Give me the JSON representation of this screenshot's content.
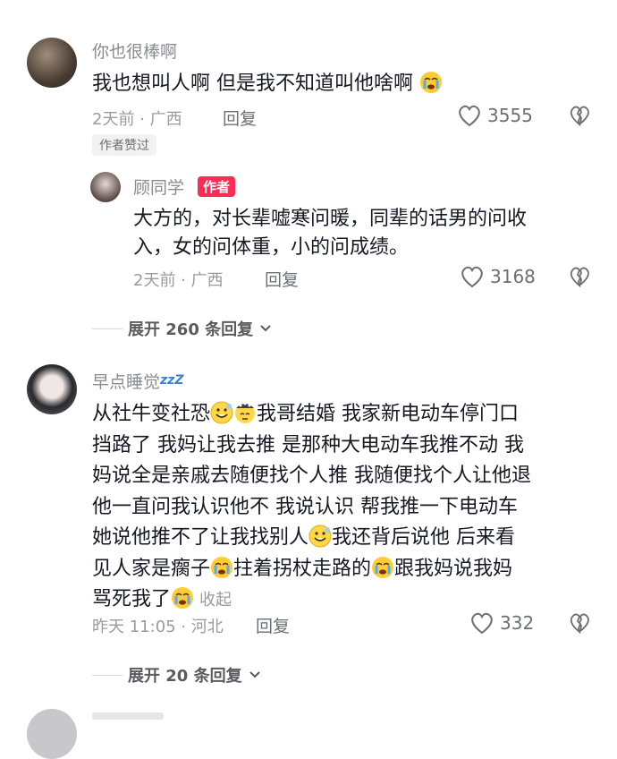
{
  "comments": [
    {
      "username": "你也很棒啊",
      "text_before": "我也想叫人啊 但是我不知道叫他啥啊",
      "emoji": "crying-face",
      "time_location": "2天前 · 广西",
      "reply_label": "回复",
      "likes": "3555",
      "liked_by_author": "作者赞过",
      "reply": {
        "username": "顾同学",
        "author_tag": "作者",
        "lines": [
          "大方的，对长辈嘘寒问暖，同辈的话男的问收",
          "入，女的问体重，小的问成绩。"
        ],
        "time_location": "2天前 · 广西",
        "reply_label": "回复",
        "likes": "3168"
      },
      "expand_label": "展开 260 条回复"
    },
    {
      "username": "早点睡觉",
      "zzz": "zzZ",
      "lines": [
        [
          "从社牛变社恐",
          "grin-emoji",
          "",
          "dizzy-emoji",
          "我哥结婚 我家新电动车停门口"
        ],
        [
          "挡路了 我妈让我去推 是那种大电动车我推不动 我"
        ],
        [
          "妈说全是亲戚去随便找个人推 我随便找个人让他退"
        ],
        [
          "他一直问我认识他不 我说认识 帮我推一下电动车"
        ],
        [
          "她说他推不了让我找别人",
          "grin-emoji",
          "我还背后说他 后来看"
        ],
        [
          "见人家是瘸子",
          "crying-face",
          "拄着拐杖走路的",
          "crying-face",
          "跟我妈说我妈"
        ],
        [
          "骂死我了",
          "crying-face",
          ""
        ]
      ],
      "collapse_label": "收起",
      "time_location": "昨天 11:05 · 河北",
      "reply_label": "回复",
      "likes": "332",
      "expand_label": "展开 20 条回复"
    }
  ],
  "colors": {
    "author_red": "#fe2c55",
    "text": "#161823",
    "secondary": "#8a8b91"
  }
}
